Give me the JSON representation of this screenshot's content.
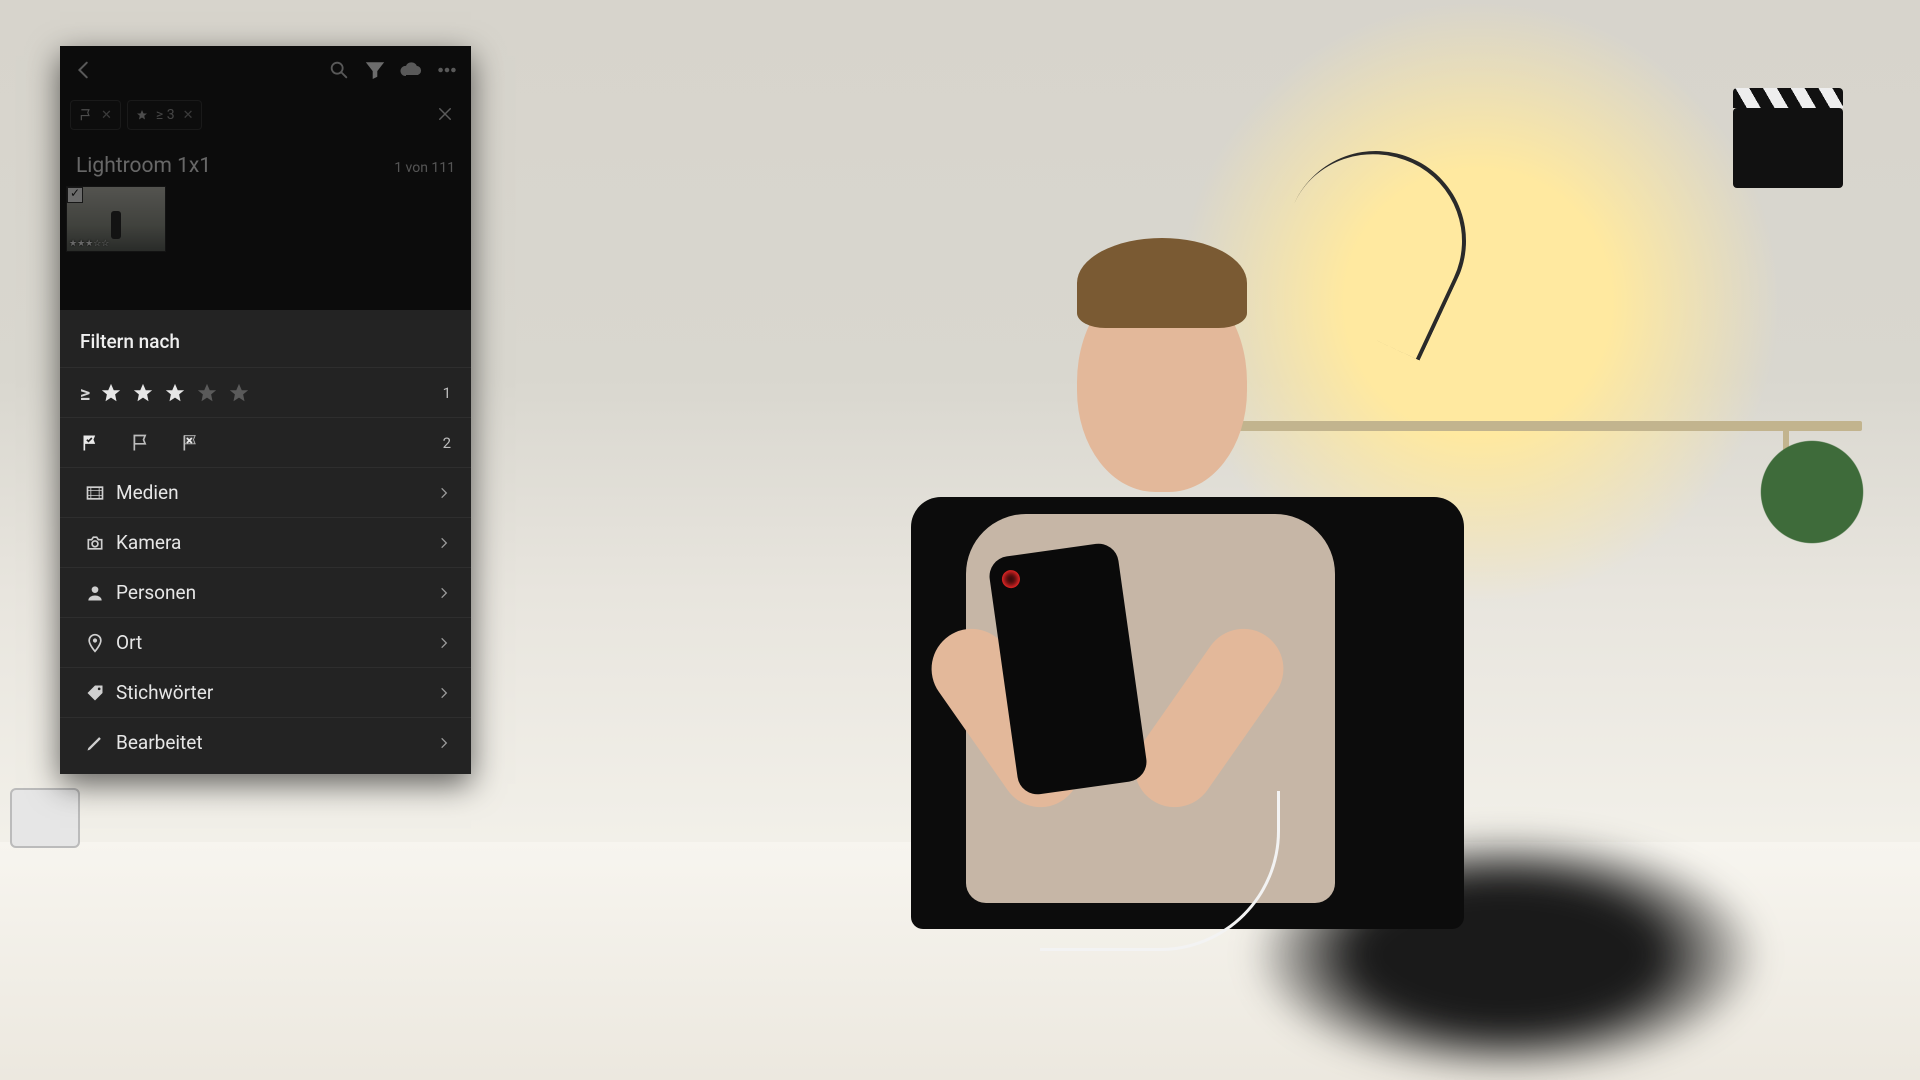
{
  "toolbar": {
    "back_icon": "back-icon",
    "search_icon": "search-icon",
    "filter_icon": "filter-icon",
    "cloud_icon": "cloud-icon",
    "more_icon": "more-icon"
  },
  "active_filters": {
    "chips": [
      {
        "icon": "flag-icon",
        "text": ""
      },
      {
        "icon": "star-icon",
        "text": "≥ 3"
      }
    ],
    "close_icon": "close-icon"
  },
  "album": {
    "title": "Lightroom 1x1",
    "count_label": "1 von 111",
    "thumbnail_rating": "★★★☆☆"
  },
  "filter": {
    "section_title": "Filtern nach",
    "rating": {
      "operator": "≥",
      "stars_active": 3,
      "stars_total": 5,
      "match_count": "1"
    },
    "flags": {
      "match_count": "2"
    },
    "categories": [
      {
        "id": "medien",
        "label": "Medien",
        "icon": "filmstrip-icon"
      },
      {
        "id": "kamera",
        "label": "Kamera",
        "icon": "camera-icon"
      },
      {
        "id": "personen",
        "label": "Personen",
        "icon": "person-icon"
      },
      {
        "id": "ort",
        "label": "Ort",
        "icon": "location-icon"
      },
      {
        "id": "stichworte",
        "label": "Stichwörter",
        "icon": "tag-icon"
      },
      {
        "id": "bearbeitet",
        "label": "Bearbeitet",
        "icon": "pencil-icon"
      }
    ]
  }
}
